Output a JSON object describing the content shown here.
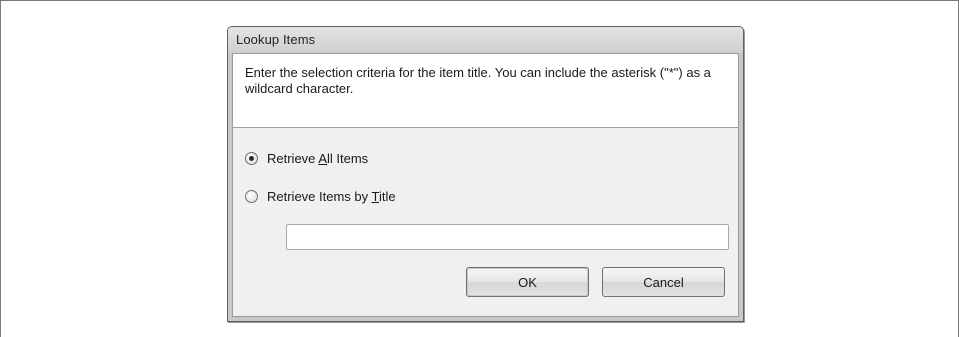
{
  "dialog": {
    "title": "Lookup Items",
    "instructions": "Enter the selection criteria for the item title. You can include the asterisk (\"*\") as a wildcard character.",
    "options": {
      "all_items": {
        "prefix": "Retrieve ",
        "mnemonic": "A",
        "suffix": "ll Items",
        "selected": true
      },
      "by_title": {
        "prefix": "Retrieve Items by ",
        "mnemonic": "T",
        "suffix": "itle",
        "selected": false
      }
    },
    "title_input": {
      "value": "",
      "placeholder": ""
    },
    "buttons": {
      "ok_label": "OK",
      "cancel_label": "Cancel"
    }
  }
}
